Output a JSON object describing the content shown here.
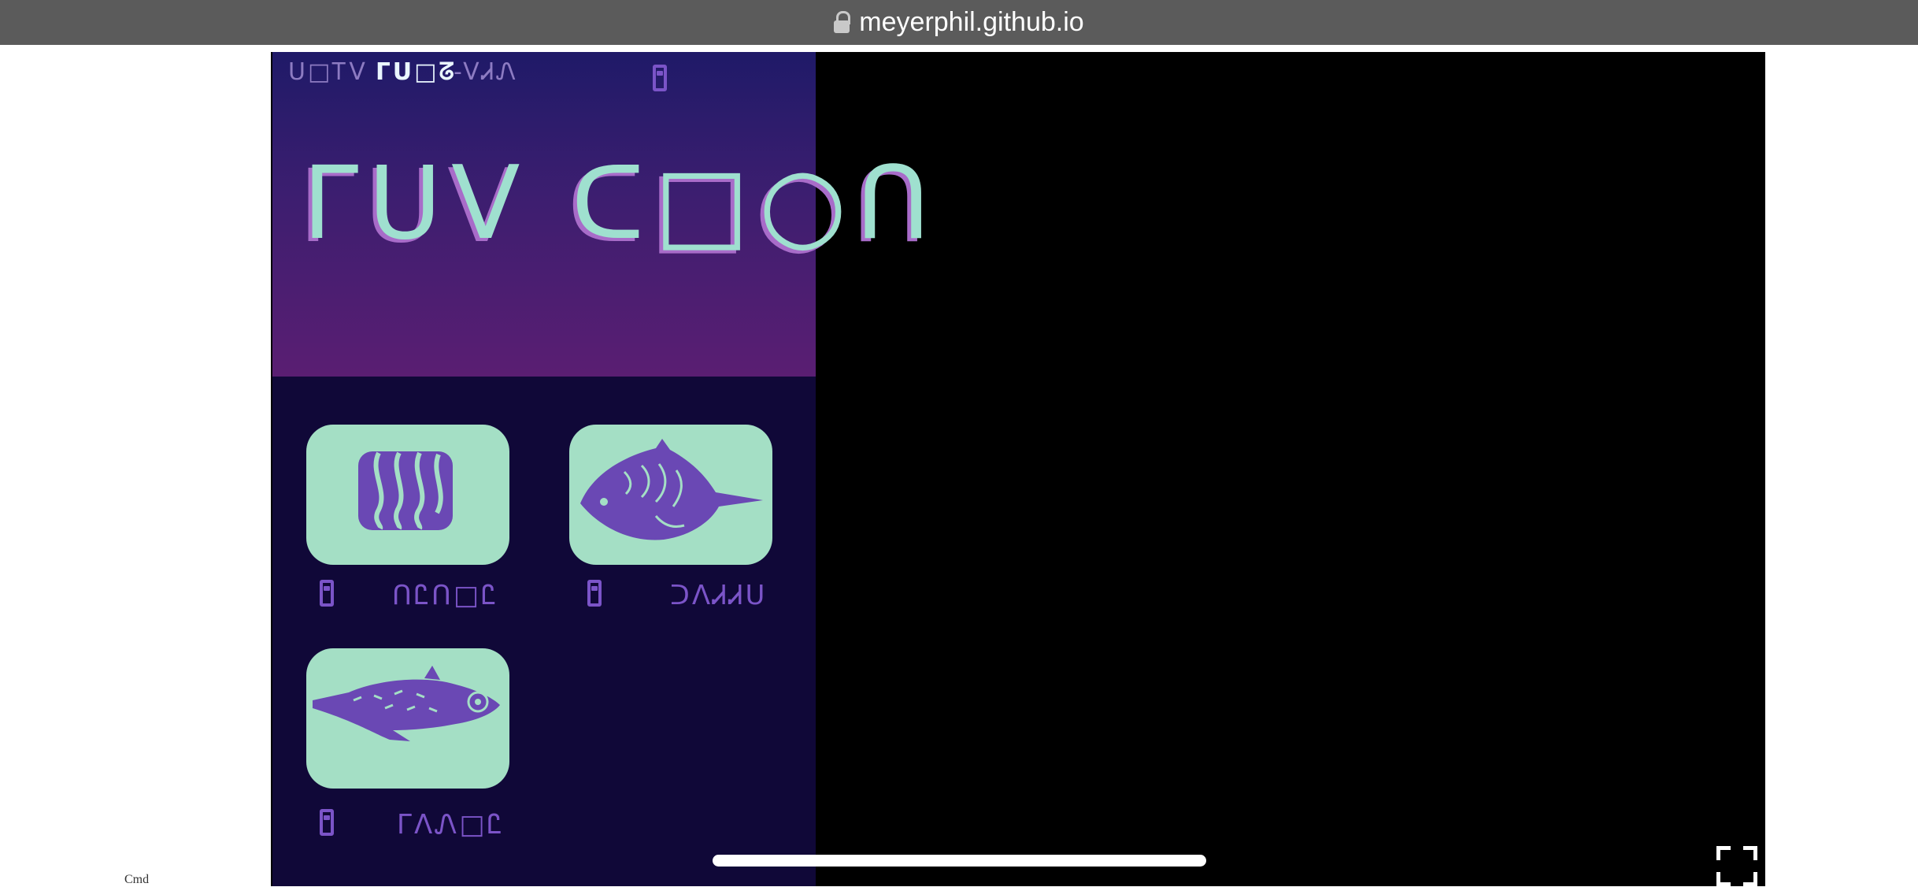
{
  "browser": {
    "url": "meyerphil.github.io",
    "lock_icon": "lock-icon"
  },
  "game": {
    "tabs": [
      {
        "label": "ᑌ□ᎢV",
        "active": false
      },
      {
        "label": "ᒥᑌ□ᘔ",
        "active": true
      },
      {
        "label": "-VᏗᏁ",
        "active": false
      }
    ],
    "header_icon": "book-icon",
    "title": "ᒥᑌV ᑕ□○ᑎ",
    "colors": {
      "accent": "#a4dfc5",
      "panel": "#100838",
      "glyph": "#7b54c8"
    },
    "items": [
      {
        "image": "wavy-block-icon",
        "book_icon": "book-icon",
        "label": "ᑎᏝᑎ□Ꮭ"
      },
      {
        "image": "spiny-fish-icon",
        "book_icon": "book-icon",
        "label": "ᑐᐱᏗᏗᑌ"
      },
      {
        "image": "long-fish-icon",
        "book_icon": "book-icon",
        "label": "ᒥᐱᏁ□Ꮭ"
      }
    ]
  },
  "footer": {
    "stray_text": "Cmd"
  }
}
